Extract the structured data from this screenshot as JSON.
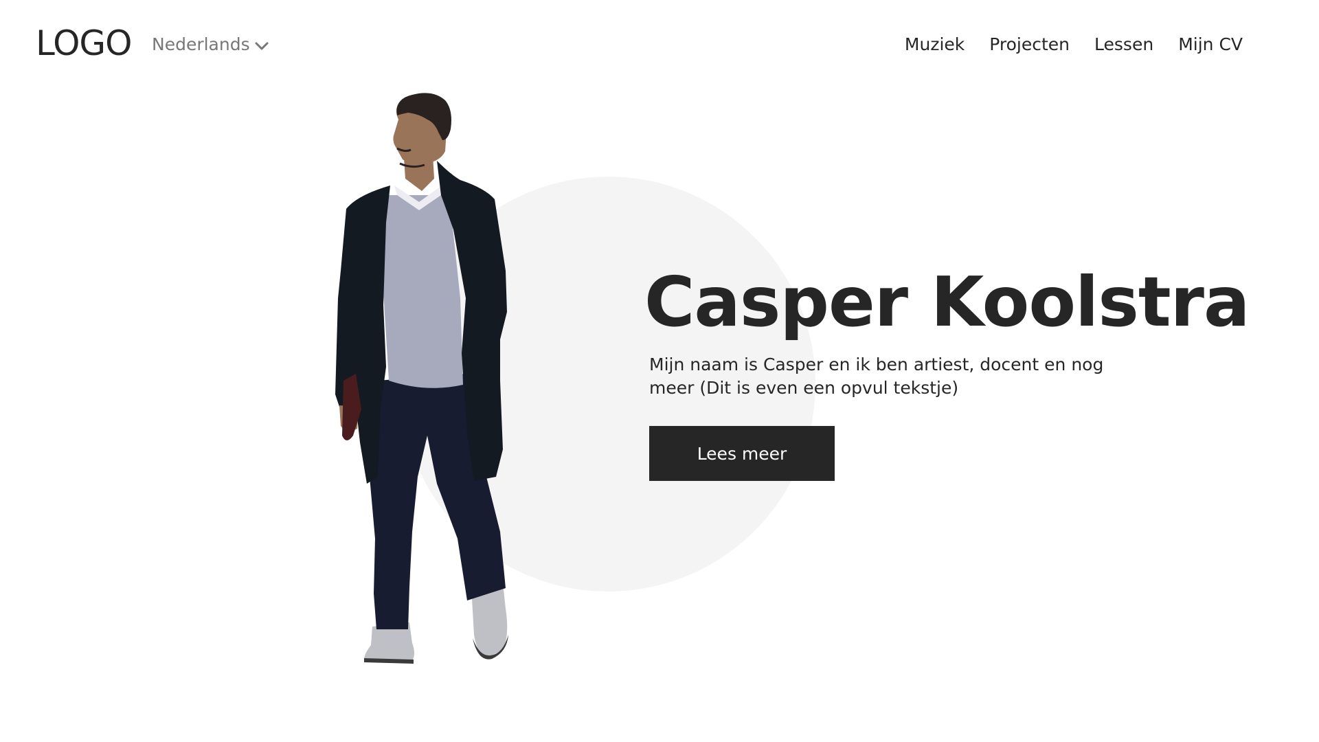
{
  "header": {
    "logo": "LOGO",
    "language": {
      "selected": "Nederlands",
      "icon": "chevron-down-icon"
    },
    "nav": [
      {
        "label": "Muziek"
      },
      {
        "label": "Projecten"
      },
      {
        "label": "Lessen"
      },
      {
        "label": "Mijn CV"
      }
    ]
  },
  "hero": {
    "name": "Casper Koolstra",
    "description": "Mijn naam is Casper en ik ben artiest, docent en nog meer (Dit is even een opvul tekstje)",
    "cta_label": "Lees meer",
    "colors": {
      "text": "#262626",
      "circle": "#f4f4f4",
      "button_bg": "#262626",
      "button_text": "#ffffff"
    }
  }
}
